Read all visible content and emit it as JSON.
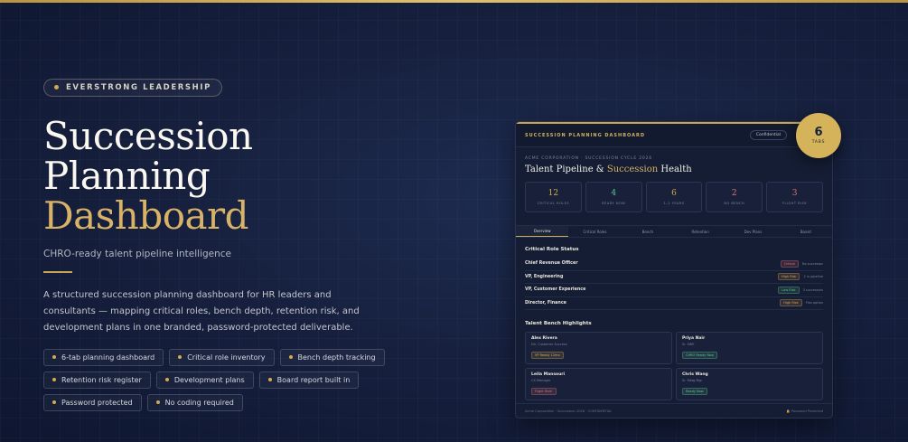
{
  "badge": "EVERSTRONG LEADERSHIP",
  "title": {
    "line1": "Succession",
    "line2": "Planning",
    "line3": "Dashboard"
  },
  "subtitle": "CHRO-ready talent pipeline intelligence",
  "description": "A structured succession planning dashboard for HR leaders and consultants — mapping critical roles, bench depth, retention risk, and development plans in one branded, password-protected deliverable.",
  "features": [
    "6-tab planning dashboard",
    "Critical role inventory",
    "Bench depth tracking",
    "Retention risk register",
    "Development plans",
    "Board report built in",
    "Password protected",
    "No coding required"
  ],
  "colors": {
    "gold": "#d4aa50",
    "navy": "#16203a",
    "critical": "#e0707a",
    "high_risk": "#e0a050",
    "ready": "#5fc48a"
  },
  "tabs_badge": {
    "count": "6",
    "label": "TABS"
  },
  "dashboard": {
    "header": "SUCCESSION PLANNING DASHBOARD",
    "confidential": "Confidential",
    "eyebrow": "ACME CORPORATION · SUCCESSION CYCLE 2026",
    "title_a": "Talent Pipeline & ",
    "title_b": "Succession",
    "title_c": " Health",
    "stats": [
      {
        "value": "12",
        "label": "CRITICAL ROLES",
        "color": "#d4aa50"
      },
      {
        "value": "4",
        "label": "READY NOW",
        "color": "#5fc48a"
      },
      {
        "value": "6",
        "label": "1–2 YEARS",
        "color": "#d4aa50"
      },
      {
        "value": "2",
        "label": "NO BENCH",
        "color": "#e0707a"
      },
      {
        "value": "3",
        "label": "FLIGHT RISK",
        "color": "#e0707a"
      }
    ],
    "tabs": [
      "Overview",
      "Critical Roles",
      "Bench",
      "Retention",
      "Dev Plans",
      "Board"
    ],
    "critical_title": "Critical Role Status",
    "roles": [
      {
        "name": "Chief Revenue Officer",
        "badge": "Critical",
        "note": "No successor"
      },
      {
        "name": "VP, Engineering",
        "badge": "High Risk",
        "note": "2 in pipeline"
      },
      {
        "name": "VP, Customer Experience",
        "badge": "Low Risk",
        "note": "3 successors"
      },
      {
        "name": "Director, Finance",
        "badge": "High Risk",
        "note": "Flex option"
      }
    ],
    "bench_title": "Talent Bench Highlights",
    "bench": [
      {
        "name": "Alex Rivera",
        "role": "Dir, Customer Success",
        "badge": "VP Ready 12mo"
      },
      {
        "name": "Priya Nair",
        "role": "Sr. SWE",
        "badge": "CHRO Ready Now"
      },
      {
        "name": "Leila Mansouri",
        "role": "CX Manager",
        "badge": "Flight Risk!"
      },
      {
        "name": "Chris Wang",
        "role": "Sr. Mktg Mgr",
        "badge": "Ready Now"
      }
    ],
    "footer_left": "Acme Corporation · Succession 2026 · CONFIDENTIAL",
    "footer_right": "🔒 Password Protected"
  }
}
